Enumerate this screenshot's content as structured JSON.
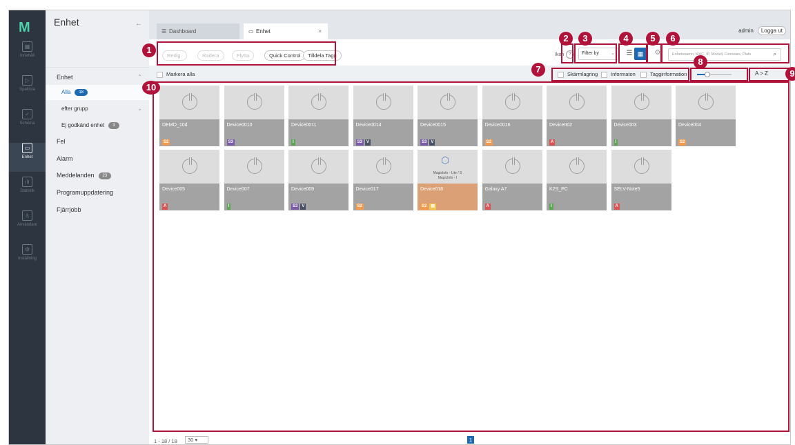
{
  "rail": {
    "items": [
      {
        "label": "Innehåll",
        "icon": "content-icon",
        "glyph": "▦"
      },
      {
        "label": "Spellista",
        "icon": "playlist-icon",
        "glyph": "▷"
      },
      {
        "label": "Schema",
        "icon": "calendar-icon",
        "glyph": "✓"
      },
      {
        "label": "Enhet",
        "icon": "display-icon",
        "glyph": "▭"
      },
      {
        "label": "Statistik",
        "icon": "chart-icon",
        "glyph": "ılı"
      },
      {
        "label": "Användare",
        "icon": "user-icon",
        "glyph": "♙"
      },
      {
        "label": "Inställning",
        "icon": "gear-icon",
        "glyph": "⚙"
      }
    ]
  },
  "sidenav": {
    "title": "Enhet",
    "section": "Enhet",
    "all_label": "Alla",
    "all_count": "18",
    "group_label": "efter grupp",
    "unapproved_label": "Ej godkänd enhet",
    "unapproved_count": "3",
    "error_label": "Fel",
    "alarm_label": "Alarm",
    "messages_label": "Meddelanden",
    "messages_count": "23",
    "update_label": "Programuppdatering",
    "remote_label": "Fjärrjobb"
  },
  "header": {
    "tab_dashboard": "Dashboard",
    "tab_unit": "Enhet",
    "user": "admin",
    "logout": "Logga ut"
  },
  "toolbar": {
    "edit": "Redig.",
    "delete": "Radera",
    "move": "Flytta",
    "quick_control": "Quick Control",
    "assign_tag": "Tilldela Tagg",
    "icon_label": "Ikon",
    "help": "?",
    "filter": "Filter by",
    "search_placeholder": "Enhetsnamn, MAC, IP, Modell, Firmware, Plats"
  },
  "filterrow": {
    "select_all": "Markera alla",
    "screen_capture": "Skärmlagring",
    "information": "Informaton",
    "tag_info": "Tagginformation",
    "sort": "A > Z",
    "slider_level": 0.3
  },
  "devices": [
    {
      "name": "DEMO_10d",
      "tags": [
        "S2"
      ]
    },
    {
      "name": "Device0010",
      "tags": [
        "S3"
      ]
    },
    {
      "name": "Device0011",
      "tags": [
        "I"
      ]
    },
    {
      "name": "Device0014",
      "tags": [
        "S3",
        "V"
      ]
    },
    {
      "name": "Device0015",
      "tags": [
        "S3",
        "V"
      ]
    },
    {
      "name": "Device0016",
      "tags": [
        "S2"
      ]
    },
    {
      "name": "Device002",
      "tags": [
        "A"
      ]
    },
    {
      "name": "Device003",
      "tags": [
        "I"
      ]
    },
    {
      "name": "Device004",
      "tags": [
        "S2"
      ]
    },
    {
      "name": "Device005",
      "tags": [
        "A"
      ]
    },
    {
      "name": "Device007",
      "tags": [
        "I"
      ]
    },
    {
      "name": "Device009",
      "tags": [
        "S3",
        "V"
      ]
    },
    {
      "name": "Device017",
      "tags": [
        "S2"
      ]
    },
    {
      "name": "Device018",
      "tags": [
        "S2",
        "F"
      ],
      "magicinfo": [
        "MagicInfo - Lite / S",
        "MagicInfo - I"
      ],
      "warn": true
    },
    {
      "name": "Galaxy A7",
      "tags": [
        "A"
      ]
    },
    {
      "name": "K2S_PC",
      "tags": [
        "I"
      ]
    },
    {
      "name": "SELV-Note5",
      "tags": [
        "A"
      ]
    }
  ],
  "pager": {
    "range": "1 - 18 / 18",
    "page_size": "30",
    "page": "1"
  },
  "callouts": [
    "1",
    "2",
    "3",
    "4",
    "5",
    "6",
    "7",
    "8",
    "9",
    "10"
  ],
  "colors": {
    "accent": "#1d6ab3",
    "callout": "#b0123a",
    "rail": "#2d3540"
  }
}
